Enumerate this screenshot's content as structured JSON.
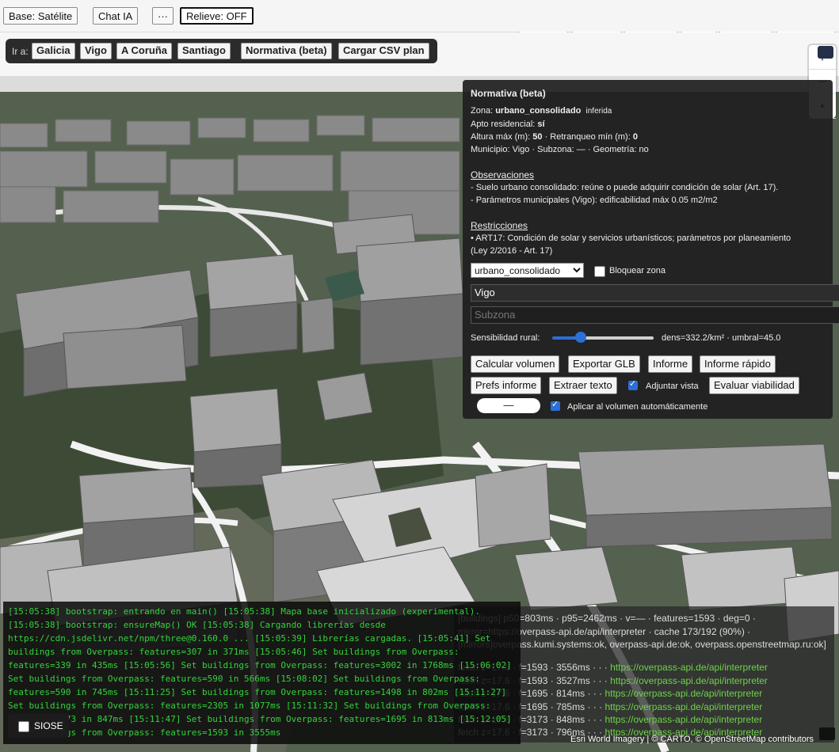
{
  "topbar": {
    "base_button": "Base: Satélite",
    "chat_button": "Chat IA",
    "more_button": "···",
    "relief_button": "Relieve: OFF"
  },
  "goto_bar": {
    "label": "Ir a:",
    "places": [
      "Galicia",
      "Vigo",
      "A Coruña",
      "Santiago"
    ],
    "normativa_button": "Normativa (beta)",
    "csv_button": "Cargar CSV plan"
  },
  "map_controls": {
    "zoom_in": "+",
    "zoom_out": "−",
    "compass": "▲"
  },
  "panel": {
    "title": "Normativa (beta)",
    "zona_label": "Zona:",
    "zona_value": "urbano_consolidado",
    "zona_note": "inferida",
    "apto_label": "Apto residencial:",
    "apto_value": "sí",
    "altura_label": "Altura máx (m):",
    "altura_value": "50",
    "retranqueo_label": "· Retranqueo mín (m):",
    "retranqueo_value": "0",
    "municipio_line": "Municipio: Vigo · Subzona: — · Geometría: no",
    "observaciones_heading": "Observaciones",
    "observaciones": [
      "- Suelo urbano consolidado: reúne o puede adquirir condición de solar (Art. 17).",
      "- Parámetros municipales (Vigo): edificabilidad máx 0.05 m2/m2"
    ],
    "restricciones_heading": "Restricciones",
    "restricciones": [
      "• ART17: Condición de solar y servicios urbanísticos; parámetros por planeamiento",
      "(Ley 2/2016 - Art. 17)"
    ],
    "zona_select_value": "urbano_consolidado",
    "bloquear_label": "Bloquear zona",
    "municipio_input": "Vigo",
    "subzona_placeholder": "Subzona",
    "sensibilidad_label": "Sensibilidad rural:",
    "sensibilidad_level": 0.28,
    "sensibilidad_readout": "dens=332.2/km² · umbral=45.0",
    "buttons_row1": [
      "Calcular volumen",
      "Exportar GLB",
      "Informe",
      "Informe rápido"
    ],
    "buttons_row2": [
      "Prefs informe",
      "Extraer texto"
    ],
    "adjuntar_label": "Adjuntar vista",
    "evaluar_button": "Evaluar viabilidad",
    "pill_button": "—",
    "aplicar_label": "Aplicar al volumen automáticamente"
  },
  "overpass_box": {
    "rows": [
      "[buildings] p50=803ms · p95=2462ms · v=— · features=1593 · deg=0 ·",
      "mirror=https://overpass-api.de/api/interpreter · cache 173/192 (90%) ·",
      "[mirrors]overpass.kumi.systems:ok, overpass-api.de:ok, overpass.openstreetmap.ru:ok]"
    ],
    "fetch_rows": [
      {
        "prefix": "fetch z=17.6 · f=1593 · 3556ms",
        "url": "https://overpass-api.de/api/interpreter"
      },
      {
        "prefix": "fetch z=17.6 · f=1593 · 3527ms",
        "url": "https://overpass-api.de/api/interpreter"
      },
      {
        "prefix": "fetch z=17.6 · f=1695 · 814ms",
        "url": "https://overpass-api.de/api/interpreter"
      },
      {
        "prefix": "fetch z=17.6 · f=1695 · 785ms",
        "url": "https://overpass-api.de/api/interpreter"
      },
      {
        "prefix": "fetch z=17.6 · f=3173 · 848ms",
        "url": "https://overpass-api.de/api/interpreter"
      },
      {
        "prefix": "fetch z=17.6 · f=3173 · 796ms",
        "url": "https://overpass-api.de/api/interpreter"
      }
    ]
  },
  "log": {
    "text": "[15:05:38] bootstrap: entrando en main() [15:05:38] Mapa base inicializado (experimental). [15:05:38] bootstrap: ensureMap() OK [15:05:38] Cargando librerías desde https://cdn.jsdelivr.net/npm/three@0.160.0 ... [15:05:39] Librerías cargadas. [15:05:41] Set buildings from Overpass: features=307 in 371ms [15:05:46] Set buildings from Overpass: features=339 in 435ms [15:05:56] Set buildings from Overpass: features=3002 in 1768ms [15:06:02] Set buildings from Overpass: features=590 in 566ms [15:08:02] Set buildings from Overpass: features=590 in 745ms [15:11:25] Set buildings from Overpass: features=1498 in 802ms [15:11:27] Set buildings from Overpass: features=2305 in 1077ms [15:11:32] Set buildings from Overpass: features=3173 in 847ms [15:11:47] Set buildings from Overpass: features=1695 in 813ms [15:12:05] Set buildings from Overpass: features=1593 in 3555ms"
  },
  "siose_label": "SIOSE",
  "attribution": "Esri World Imagery | © CARTO, © OpenStreetMap contributors",
  "colors": {
    "accent": "#2c6fd6",
    "log_text": "#33d33a",
    "url_text": "#6fd34a"
  }
}
